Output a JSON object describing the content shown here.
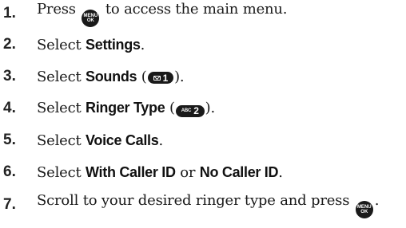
{
  "steps": [
    {
      "number": "1.",
      "parts": {
        "a": "Press ",
        "key_top": "MENU",
        "key_bottom": "OK",
        "b": " to access the main menu."
      }
    },
    {
      "number": "2.",
      "parts": {
        "a": "Select ",
        "bold": "Settings",
        "b": "."
      }
    },
    {
      "number": "3.",
      "parts": {
        "a": "Select ",
        "bold": "Sounds",
        "b": " (",
        "key_digit": "1",
        "c": ")."
      }
    },
    {
      "number": "4.",
      "parts": {
        "a": "Select ",
        "bold": "Ringer Type",
        "b": " (",
        "key_sub": "ABC",
        "key_digit": "2",
        "c": ")."
      }
    },
    {
      "number": "5.",
      "parts": {
        "a": "Select ",
        "bold": "Voice Calls",
        "b": "."
      }
    },
    {
      "number": "6.",
      "parts": {
        "a": "Select ",
        "bold1": "With Caller ID",
        "b": " or ",
        "bold2": "No Caller ID",
        "c": "."
      }
    },
    {
      "number": "7.",
      "parts": {
        "a": "Scroll to your desired ringer type and press ",
        "key_top": "MENU",
        "key_bottom": "OK",
        "b": "."
      }
    }
  ]
}
